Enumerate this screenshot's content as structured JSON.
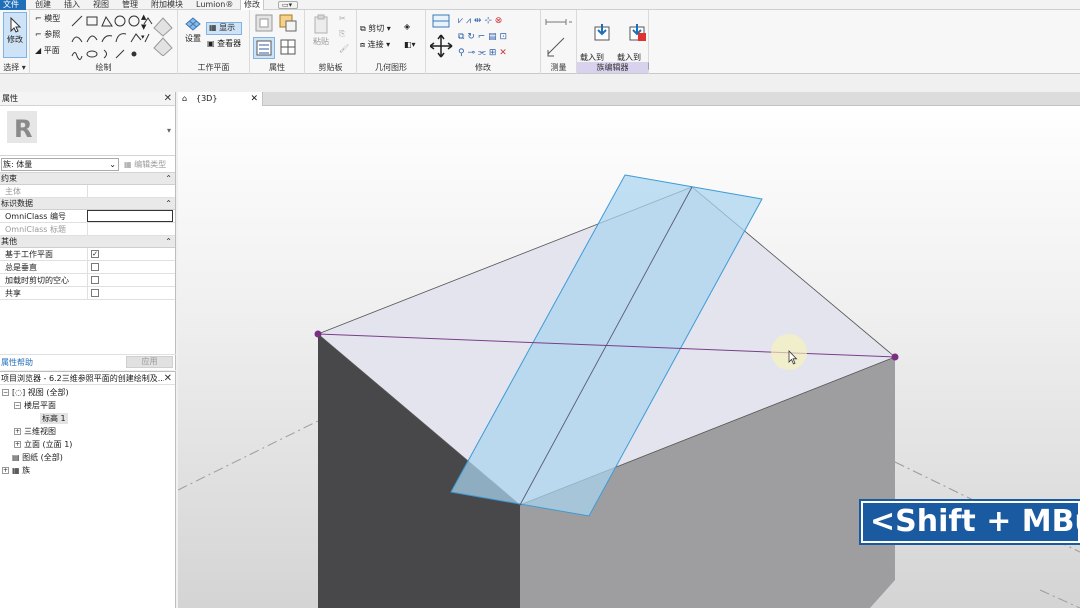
{
  "menu": {
    "tabs": [
      "文件",
      "创建",
      "插入",
      "视图",
      "管理",
      "附加模块",
      "Lumion®",
      "修改"
    ]
  },
  "ribbon": {
    "select": {
      "modify": "修改",
      "label": "选择 ▾"
    },
    "draw": {
      "model": "模型",
      "ref": "参照",
      "plane": "平面",
      "label": "绘制"
    },
    "workplane": {
      "set": "设置",
      "show": "显示",
      "viewer": "查看器",
      "label": "工作平面"
    },
    "properties": {
      "label": "属性"
    },
    "clipboard": {
      "paste": "粘贴",
      "label": "剪贴板"
    },
    "geometry": {
      "cut": "剪切",
      "join": "连接",
      "label": "几何图形"
    },
    "modify": {
      "label": "修改"
    },
    "measure": {
      "label": "测量"
    },
    "family_editor": {
      "load_to_project": "载入到\n项目",
      "load_and_close": "载入到\n项目并关闭",
      "label": "族编辑器"
    }
  },
  "properties_panel": {
    "title": "属性",
    "family": "族: 体量",
    "edit_type": "编辑类型",
    "sections": {
      "constraints": "约束",
      "identity": "标识数据",
      "other": "其他"
    },
    "rows": {
      "host": "主体",
      "omniclass_number": "OmniClass 编号",
      "omniclass_title": "OmniClass 标题",
      "work_plane_based": "基于工作平面",
      "always_vertical": "总是垂直",
      "cut_voids": "加载时剪切的空心",
      "shared": "共享"
    },
    "help": "属性帮助",
    "apply": "应用"
  },
  "project_browser": {
    "title": "项目浏览器 - 6.2三维参照平面的创建绘制及...",
    "nodes": {
      "views": "视图 (全部)",
      "floor_plans": "楼层平面",
      "level1": "标高 1",
      "3d_views": "三维视图",
      "elevations": "立面 (立面 1)",
      "sheets": "图纸 (全部)",
      "families": "族"
    }
  },
  "view_tab": {
    "name": "{3D}"
  },
  "keystroke_overlay": "<Shift + MBut",
  "colors": {
    "file_tab": "#1f6fb8",
    "overlay_bg": "#1a5aa0",
    "plane_fill": "#a9d4ef",
    "plane_edge": "#3d9ad6",
    "point": "#7a2f82",
    "dark_face": "#4a4a4c",
    "gray_face": "#9d9d9f"
  }
}
